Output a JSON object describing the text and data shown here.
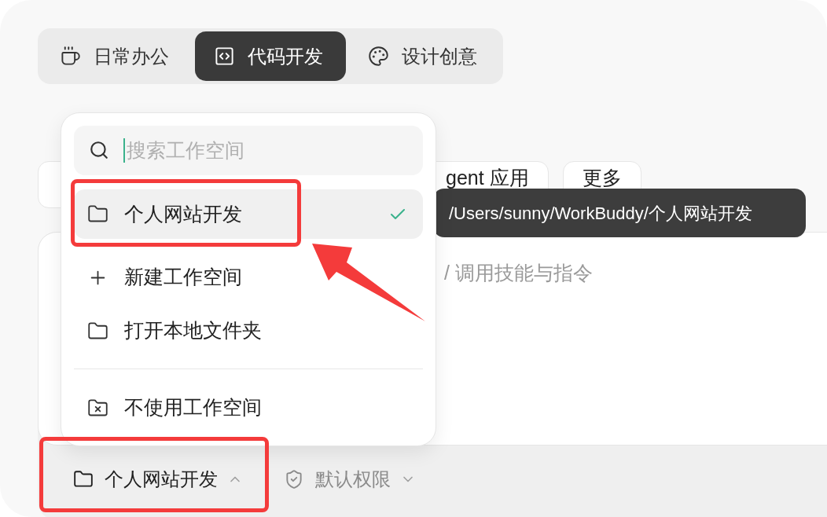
{
  "mode_tabs": [
    {
      "kind": "office",
      "label": "日常办公",
      "selected": false
    },
    {
      "kind": "code",
      "label": "代码开发",
      "selected": true
    },
    {
      "kind": "design",
      "label": "设计创意",
      "selected": false
    }
  ],
  "suggestion_chips": [
    {
      "label": "gent 应用"
    },
    {
      "label": "更多"
    }
  ],
  "prompt": {
    "placeholder": "/ 调用技能与指令"
  },
  "bottom_bar": [
    {
      "kind": "workspace",
      "label": "个人网站开发",
      "expanded": true
    },
    {
      "kind": "permission",
      "label": "默认权限",
      "expanded": false
    }
  ],
  "workspace_menu": {
    "search": {
      "placeholder": "搜索工作空间"
    },
    "workspaces": [
      {
        "label": "个人网站开发",
        "selected": true
      }
    ],
    "actions": [
      {
        "kind": "new",
        "label": "新建工作空间"
      },
      {
        "kind": "open",
        "label": "打开本地文件夹"
      }
    ],
    "footer_actions": [
      {
        "kind": "none",
        "label": "不使用工作空间"
      }
    ]
  },
  "tooltip": {
    "text": "/Users/sunny/WorkBuddy/个人网站开发"
  }
}
